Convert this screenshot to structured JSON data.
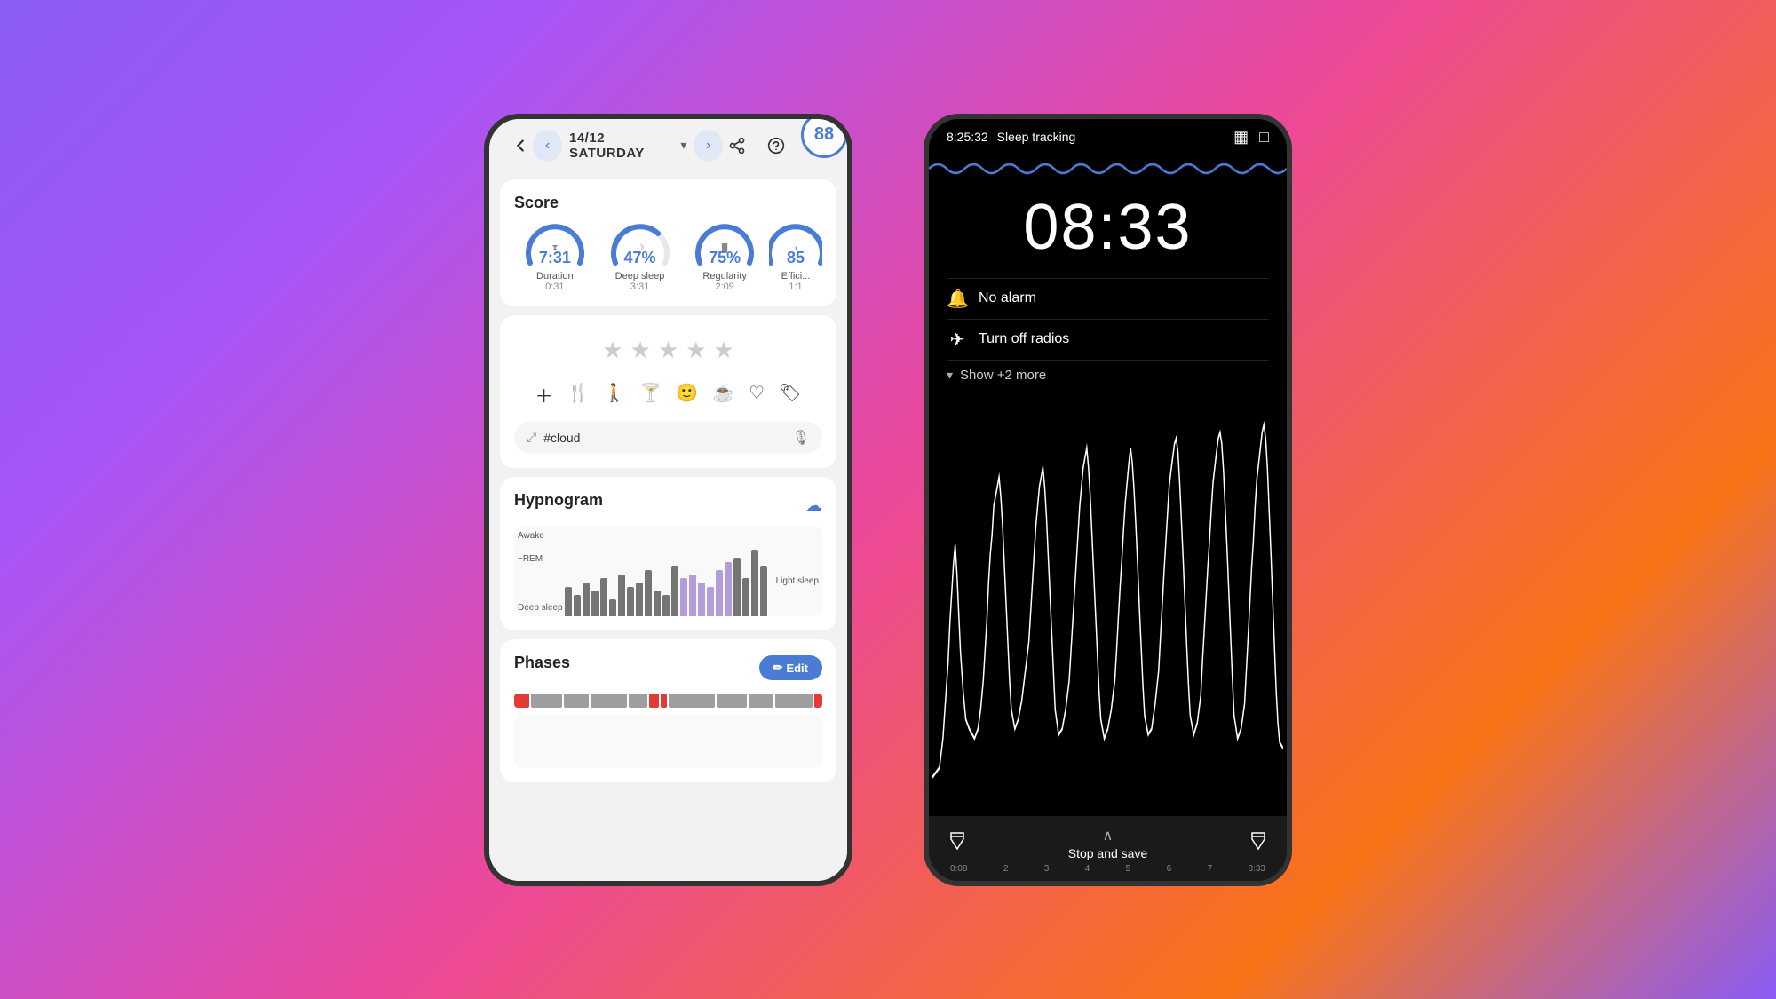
{
  "background": "purple-gradient",
  "left_phone": {
    "top_bar": {
      "back_icon": "←",
      "share_icon": "⬆",
      "help_icon": "?",
      "menu_icon": "⋮"
    },
    "date_nav": {
      "prev_arrow": "‹",
      "date_label": "14/12 SATURDAY",
      "date_dropdown": "▾",
      "next_arrow": "›"
    },
    "score_card": {
      "title": "Score",
      "score_value": "88",
      "metrics": [
        {
          "icon": "⧗",
          "value": "7:31",
          "label": "Duration",
          "sublabel": "0:31",
          "percent": 75
        },
        {
          "icon": "☽",
          "value": "47%",
          "label": "Deep sleep",
          "sublabel": "3:31",
          "percent": 47
        },
        {
          "icon": "▓",
          "value": "75%",
          "label": "Regularity",
          "sublabel": "2:09",
          "percent": 75
        },
        {
          "icon": "◑",
          "value": "85",
          "label": "Effici...",
          "sublabel": "1:1",
          "percent": 85
        }
      ]
    },
    "rating_card": {
      "stars": [
        "★",
        "★",
        "★",
        "★",
        "★"
      ],
      "icons": [
        "＋",
        "🍴",
        "🚶",
        "🍸",
        "😊",
        "☕",
        "♡",
        "🏷"
      ],
      "tag_placeholder": "#cloud",
      "expand_icon": "⤢",
      "mic_icon": "🎙"
    },
    "hypnogram": {
      "title": "Hypnogram",
      "cloud_icon": "☁",
      "labels": {
        "awake": "Awake",
        "rem": "~REM",
        "light": "Light sleep",
        "deep": "Deep sleep"
      },
      "bars": [
        35,
        25,
        40,
        30,
        45,
        20,
        50,
        35,
        40,
        55,
        30,
        25,
        60,
        45,
        50,
        40,
        35,
        55,
        65,
        70,
        45,
        80,
        60
      ]
    },
    "phases": {
      "title": "Phases",
      "edit_label": "Edit",
      "edit_icon": "✏",
      "bar_segments": [
        {
          "color": "#e53935",
          "width": "5%"
        },
        {
          "color": "#9e9e9e",
          "width": "10%"
        },
        {
          "color": "#9e9e9e",
          "width": "8%"
        },
        {
          "color": "#9e9e9e",
          "width": "12%"
        },
        {
          "color": "#9e9e9e",
          "width": "6%"
        },
        {
          "color": "#e53935",
          "width": "3%"
        },
        {
          "color": "#e53935",
          "width": "2%"
        },
        {
          "color": "#9e9e9e",
          "width": "15%"
        },
        {
          "color": "#9e9e9e",
          "width": "10%"
        },
        {
          "color": "#9e9e9e",
          "width": "8%"
        },
        {
          "color": "#9e9e9e",
          "width": "12%"
        },
        {
          "color": "#e53935",
          "width": "3%"
        },
        {
          "color": "#9e9e9e",
          "width": "6%"
        }
      ]
    }
  },
  "right_phone": {
    "status_bar": {
      "time": "8:25:32",
      "title": "Sleep tracking",
      "grid_icon": "▦",
      "window_icon": "□"
    },
    "wave": "sinusoidal",
    "big_time": "08:33",
    "notifications": [
      {
        "icon": "🔔",
        "text": "No alarm"
      },
      {
        "icon": "✈",
        "text": "Turn off radios"
      }
    ],
    "show_more": "Show +2 more",
    "time_axis": [
      "0:08",
      "2",
      "3",
      "4",
      "5",
      "6",
      "7",
      "8:33"
    ],
    "bottom": {
      "left_icon": "🔦",
      "stop_save": "Stop and save",
      "stop_save_arrow": "∧",
      "right_icon": "🔦"
    }
  }
}
